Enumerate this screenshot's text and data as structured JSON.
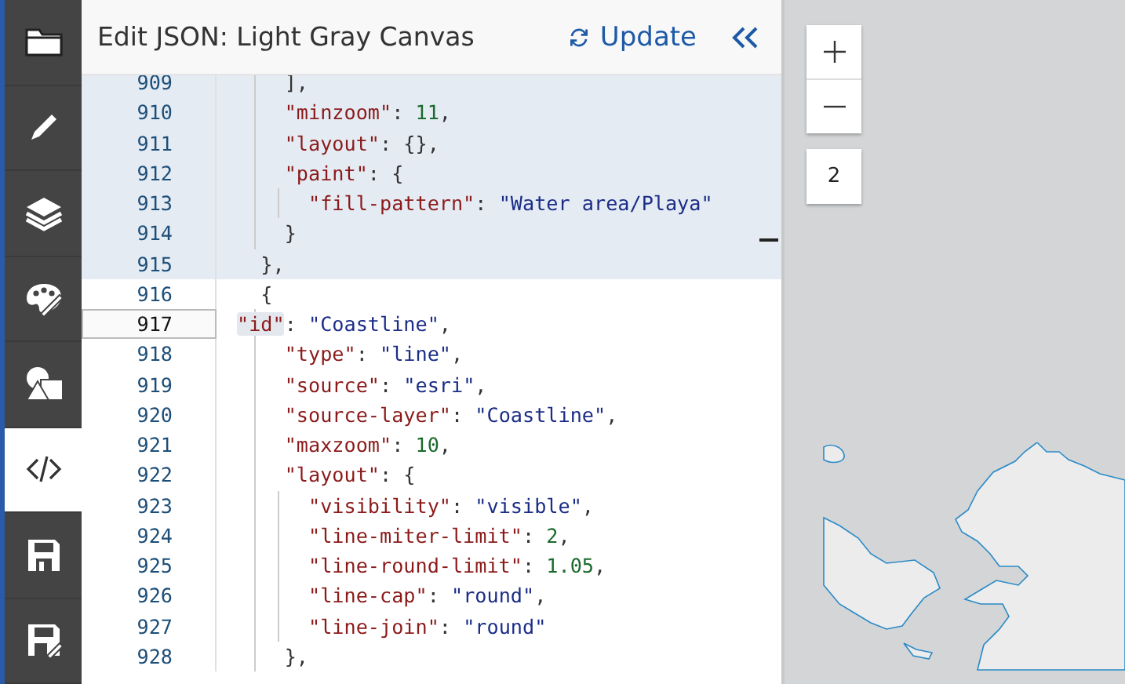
{
  "sidebar": {
    "items": [
      {
        "kind": "folder",
        "selected": false
      },
      {
        "kind": "pencil",
        "selected": false
      },
      {
        "kind": "layers",
        "selected": false
      },
      {
        "kind": "palette",
        "selected": false
      },
      {
        "kind": "shapes",
        "selected": false
      },
      {
        "kind": "code",
        "selected": true
      },
      {
        "kind": "save",
        "selected": false
      },
      {
        "kind": "save-as",
        "selected": false
      }
    ]
  },
  "header": {
    "title": "Edit JSON: Light Gray Canvas",
    "update_button": "Update"
  },
  "editor": {
    "lines": [
      {
        "number": "909",
        "selected": true,
        "active": false,
        "tokens": [
          {
            "kind": "punct",
            "text": "    ],"
          }
        ]
      },
      {
        "number": "910",
        "selected": true,
        "active": false,
        "tokens": [
          {
            "kind": "key",
            "text": "    \"minzoom\""
          },
          {
            "kind": "punct",
            "text": ": "
          },
          {
            "kind": "number",
            "text": "11"
          },
          {
            "kind": "punct",
            "text": ","
          }
        ]
      },
      {
        "number": "911",
        "selected": true,
        "active": false,
        "tokens": [
          {
            "kind": "key",
            "text": "    \"layout\""
          },
          {
            "kind": "punct",
            "text": ": {},"
          }
        ]
      },
      {
        "number": "912",
        "selected": true,
        "active": false,
        "tokens": [
          {
            "kind": "key",
            "text": "    \"paint\""
          },
          {
            "kind": "punct",
            "text": ": {"
          }
        ]
      },
      {
        "number": "913",
        "selected": true,
        "active": false,
        "tokens": [
          {
            "kind": "key",
            "text": "      \"fill-pattern\""
          },
          {
            "kind": "punct",
            "text": ": "
          },
          {
            "kind": "string",
            "text": "\"Water area/Playa\""
          }
        ]
      },
      {
        "number": "914",
        "selected": true,
        "active": false,
        "tokens": [
          {
            "kind": "punct",
            "text": "    }"
          }
        ]
      },
      {
        "number": "915",
        "selected": true,
        "active": false,
        "tokens": [
          {
            "kind": "punct",
            "text": "  },"
          }
        ]
      },
      {
        "number": "916",
        "selected": false,
        "active": false,
        "tokens": [
          {
            "kind": "punct",
            "text": "  {"
          }
        ]
      },
      {
        "number": "917",
        "selected": false,
        "active": true,
        "tokens": [
          {
            "kind": "key",
            "text": "    \"id\"",
            "highlighted": true
          },
          {
            "kind": "punct",
            "text": ": "
          },
          {
            "kind": "string",
            "text": "\"Coastline\""
          },
          {
            "kind": "punct",
            "text": ","
          }
        ]
      },
      {
        "number": "918",
        "selected": false,
        "active": false,
        "tokens": [
          {
            "kind": "key",
            "text": "    \"type\""
          },
          {
            "kind": "punct",
            "text": ": "
          },
          {
            "kind": "string",
            "text": "\"line\""
          },
          {
            "kind": "punct",
            "text": ","
          }
        ]
      },
      {
        "number": "919",
        "selected": false,
        "active": false,
        "tokens": [
          {
            "kind": "key",
            "text": "    \"source\""
          },
          {
            "kind": "punct",
            "text": ": "
          },
          {
            "kind": "string",
            "text": "\"esri\""
          },
          {
            "kind": "punct",
            "text": ","
          }
        ]
      },
      {
        "number": "920",
        "selected": false,
        "active": false,
        "tokens": [
          {
            "kind": "key",
            "text": "    \"source-layer\""
          },
          {
            "kind": "punct",
            "text": ": "
          },
          {
            "kind": "string",
            "text": "\"Coastline\""
          },
          {
            "kind": "punct",
            "text": ","
          }
        ]
      },
      {
        "number": "921",
        "selected": false,
        "active": false,
        "tokens": [
          {
            "kind": "key",
            "text": "    \"maxzoom\""
          },
          {
            "kind": "punct",
            "text": ": "
          },
          {
            "kind": "number",
            "text": "10"
          },
          {
            "kind": "punct",
            "text": ","
          }
        ]
      },
      {
        "number": "922",
        "selected": false,
        "active": false,
        "tokens": [
          {
            "kind": "key",
            "text": "    \"layout\""
          },
          {
            "kind": "punct",
            "text": ": {"
          }
        ]
      },
      {
        "number": "923",
        "selected": false,
        "active": false,
        "tokens": [
          {
            "kind": "key",
            "text": "      \"visibility\""
          },
          {
            "kind": "punct",
            "text": ": "
          },
          {
            "kind": "string",
            "text": "\"visible\""
          },
          {
            "kind": "punct",
            "text": ","
          }
        ]
      },
      {
        "number": "924",
        "selected": false,
        "active": false,
        "tokens": [
          {
            "kind": "key",
            "text": "      \"line-miter-limit\""
          },
          {
            "kind": "punct",
            "text": ": "
          },
          {
            "kind": "number",
            "text": "2"
          },
          {
            "kind": "punct",
            "text": ","
          }
        ]
      },
      {
        "number": "925",
        "selected": false,
        "active": false,
        "tokens": [
          {
            "kind": "key",
            "text": "      \"line-round-limit\""
          },
          {
            "kind": "punct",
            "text": ": "
          },
          {
            "kind": "number",
            "text": "1.05"
          },
          {
            "kind": "punct",
            "text": ","
          }
        ]
      },
      {
        "number": "926",
        "selected": false,
        "active": false,
        "tokens": [
          {
            "kind": "key",
            "text": "      \"line-cap\""
          },
          {
            "kind": "punct",
            "text": ": "
          },
          {
            "kind": "string",
            "text": "\"round\""
          },
          {
            "kind": "punct",
            "text": ","
          }
        ]
      },
      {
        "number": "927",
        "selected": false,
        "active": false,
        "tokens": [
          {
            "kind": "key",
            "text": "      \"line-join\""
          },
          {
            "kind": "punct",
            "text": ": "
          },
          {
            "kind": "string",
            "text": "\"round\""
          }
        ]
      },
      {
        "number": "928",
        "selected": false,
        "active": false,
        "tokens": [
          {
            "kind": "punct",
            "text": "    },"
          }
        ]
      }
    ]
  },
  "map": {
    "kind": "picture",
    "zoom_level": "2"
  }
}
